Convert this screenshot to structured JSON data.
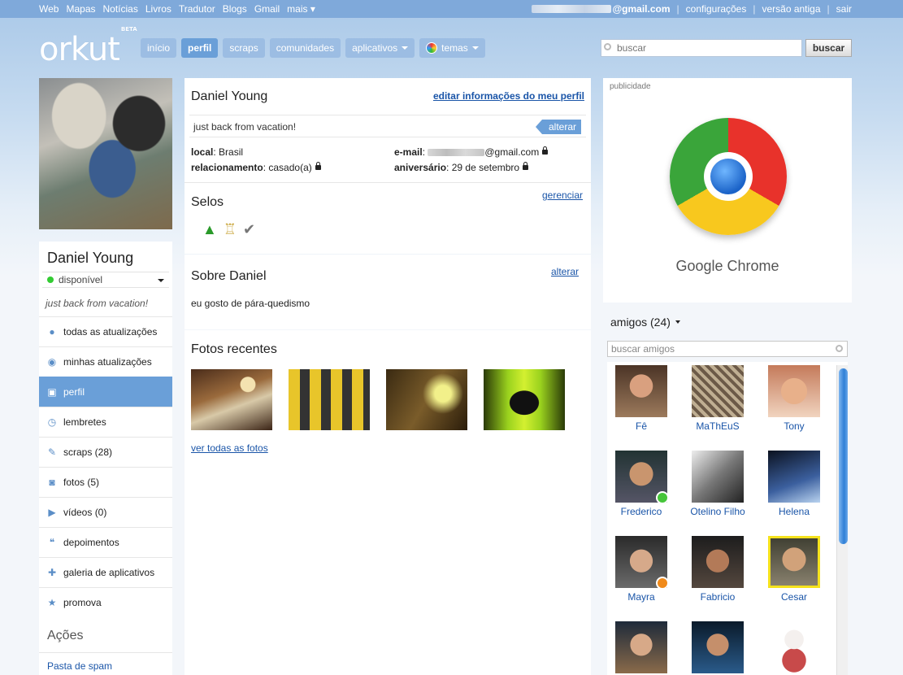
{
  "topbar": {
    "links": [
      "Web",
      "Mapas",
      "Notícias",
      "Livros",
      "Tradutor",
      "Blogs",
      "Gmail",
      "mais ▾"
    ],
    "email_suffix": "@gmail.com",
    "config": "configurações",
    "old_version": "versão antiga",
    "logout": "sair"
  },
  "header": {
    "logo": "orkut",
    "logo_badge": "BETA",
    "tabs": [
      "início",
      "perfil",
      "scraps",
      "comunidades",
      "aplicativos",
      "temas"
    ],
    "search_placeholder": "buscar",
    "search_button": "buscar"
  },
  "left": {
    "name": "Daniel Young",
    "status": "disponível",
    "tagline": "just back from vacation!",
    "menu": [
      {
        "label": "todas as atualizações",
        "icon": "alert-icon"
      },
      {
        "label": "minhas atualizações",
        "icon": "broadcast-icon"
      },
      {
        "label": "perfil",
        "icon": "profile-card-icon"
      },
      {
        "label": "lembretes",
        "icon": "alarm-clock-icon"
      },
      {
        "label": "scraps (28)",
        "icon": "scraps-icon"
      },
      {
        "label": "fotos (5)",
        "icon": "camera-icon"
      },
      {
        "label": "vídeos (0)",
        "icon": "video-icon"
      },
      {
        "label": "depoimentos",
        "icon": "quote-icon"
      },
      {
        "label": "galeria de aplicativos",
        "icon": "gamepad-icon"
      },
      {
        "label": "promova",
        "icon": "star-icon"
      }
    ],
    "actions_title": "Ações",
    "spam_link": "Pasta de spam"
  },
  "profile": {
    "name": "Daniel Young",
    "edit_link": "editar informações do meu perfil",
    "status_text": "just back from vacation!",
    "status_edit": "alterar",
    "local_label": "local",
    "local_value": "Brasil",
    "relationship_label": "relacionamento",
    "relationship_value": "casado(a)",
    "email_label": "e-mail",
    "email_suffix": "@gmail.com",
    "birthday_label": "aniversário",
    "birthday_value": "29 de setembro",
    "badges_title": "Selos",
    "badges_manage": "gerenciar",
    "about_title": "Sobre Daniel",
    "about_edit": "alterar",
    "about_text": "eu gosto de pára-quedismo",
    "photos_title": "Fotos recentes",
    "photos_link": "ver todas as fotos"
  },
  "ad": {
    "label": "publicidade",
    "title": "Google Chrome"
  },
  "friends": {
    "title": "amigos (24)",
    "search_placeholder": "buscar amigos",
    "list": [
      "Fê",
      "MaThEuS",
      "Tony",
      "Frederico",
      "Otelino Filho",
      "Helena",
      "Mayra",
      "Fabricio",
      "Cesar",
      "",
      "",
      ""
    ]
  }
}
